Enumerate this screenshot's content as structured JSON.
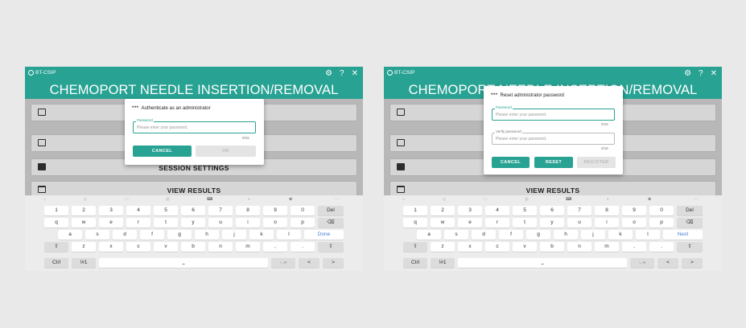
{
  "screens": [
    {
      "app_name": "BT-CSIP",
      "app_title": "CHEMOPORT NEEDLE INSERTION/REMOVAL PRACTICE MODEL",
      "icons": [
        "person-settings-icon",
        "help-icon",
        "close-icon"
      ],
      "menu": [
        "",
        "",
        "SESSION SETTINGS",
        "VIEW RESULTS"
      ],
      "dialog": {
        "title": "Authenticate as an administrator",
        "fields": [
          {
            "label": "Password",
            "placeholder": "Please enter your password.",
            "counter": "0/16"
          }
        ],
        "buttons": [
          "CANCEL",
          "OK"
        ]
      },
      "keyboard_action": "Done"
    },
    {
      "app_name": "BT-CSIP",
      "app_title": "CHEMOPORT NEEDLE INSERTION/REMOVAL PRACTICE MODEL",
      "icons": [
        "person-settings-icon",
        "help-icon",
        "close-icon"
      ],
      "menu": [
        "",
        "",
        "",
        "VIEW RESULTS"
      ],
      "dialog": {
        "title": "Reset administrator password",
        "fields": [
          {
            "label": "Password",
            "placeholder": "Please enter your password.",
            "counter": "0/16"
          },
          {
            "label": "Verify password",
            "placeholder": "Please enter your password.",
            "counter": "0/16"
          }
        ],
        "buttons": [
          "CANCEL",
          "RESET",
          "REGISTER"
        ]
      },
      "keyboard_action": "Next"
    }
  ],
  "keyboard": {
    "row1": [
      "1",
      "2",
      "3",
      "4",
      "5",
      "6",
      "7",
      "8",
      "9",
      "0",
      "Del"
    ],
    "row2": [
      "q",
      "w",
      "e",
      "r",
      "t",
      "y",
      "u",
      "i",
      "o",
      "p",
      "⌫"
    ],
    "row3": [
      "a",
      "s",
      "d",
      "f",
      "g",
      "h",
      "j",
      "k",
      "l"
    ],
    "row4": [
      "⇧",
      "z",
      "x",
      "c",
      "v",
      "b",
      "n",
      "m",
      ",",
      ".",
      "⇧"
    ],
    "row5": [
      "Ctrl",
      "!#1",
      "",
      "",
      "<",
      ">"
    ],
    "comma_period_key": "',.\n?!",
    "toolbar_symbol": "⊕"
  },
  "colors": {
    "accent": "#27a293",
    "action_key": "#4a7dd6",
    "background": "#e9e9e9"
  }
}
